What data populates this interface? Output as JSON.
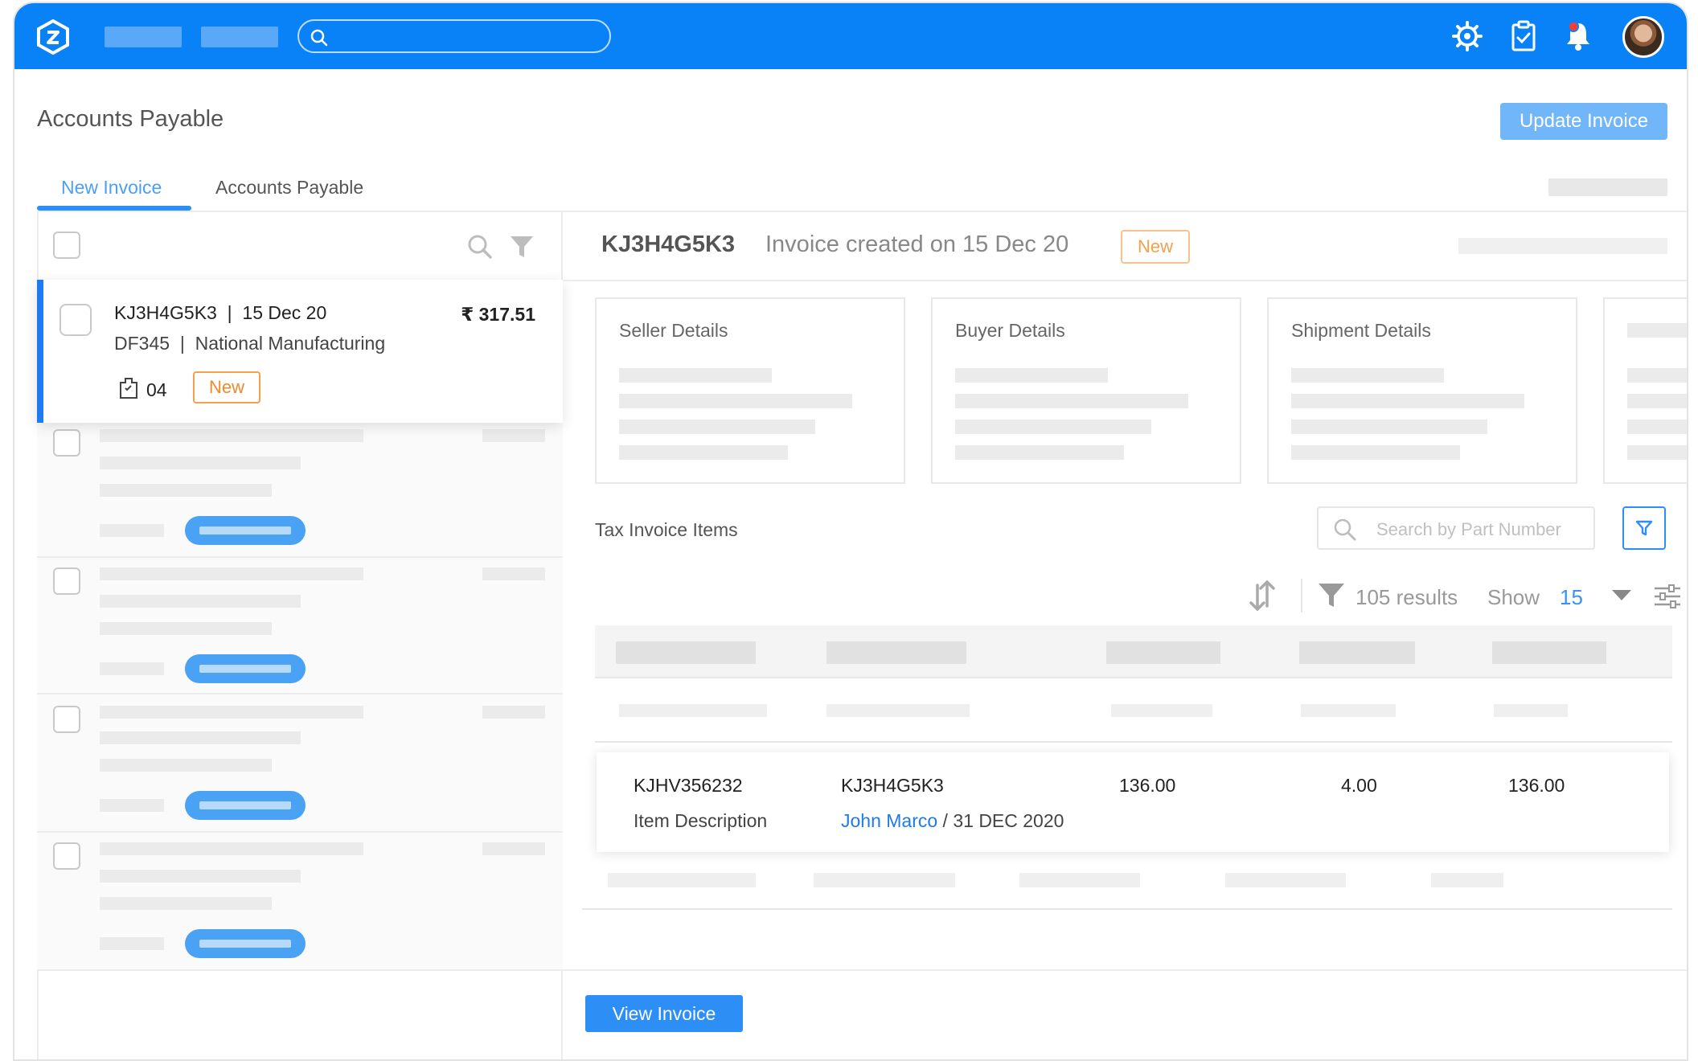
{
  "header": {
    "logo_icon": "app-logo-icon",
    "search_icon": "search-icon",
    "icons": [
      "settings-gear-icon",
      "clipboard-check-icon",
      "bell-icon"
    ],
    "brand_color": "#0a82f7"
  },
  "page": {
    "title": "Accounts Payable",
    "update_button": "Update Invoice",
    "tabs": [
      {
        "label": "New Invoice",
        "active": true
      },
      {
        "label": "Accounts Payable",
        "active": false
      }
    ]
  },
  "invoice_list": {
    "selected": {
      "id": "KJ3H4G5K3",
      "date": "15 Dec 20",
      "amount": "₹ 317.51",
      "code": "DF345",
      "vendor": "National Manufacturing",
      "count": "04",
      "status": "New"
    }
  },
  "detail": {
    "invoice_id": "KJ3H4G5K3",
    "created_text": "Invoice created on 15 Dec 20",
    "status": "New",
    "boxes": [
      "Seller Details",
      "Buyer Details",
      "Shipment Details"
    ],
    "items_title": "Tax Invoice Items",
    "search_placeholder": "Search by Part Number",
    "results_text": "105 results",
    "show_label": "Show",
    "show_value": "15",
    "row": {
      "part": "KJHV356232",
      "description": "Item Description",
      "invoice": "KJ3H4G5K3",
      "user": "John Marco",
      "date_sep": " / ",
      "date": "31 DEC 2020",
      "val1": "136.00",
      "val2": "4.00",
      "val3": "136.00"
    },
    "view_button": "View Invoice"
  }
}
